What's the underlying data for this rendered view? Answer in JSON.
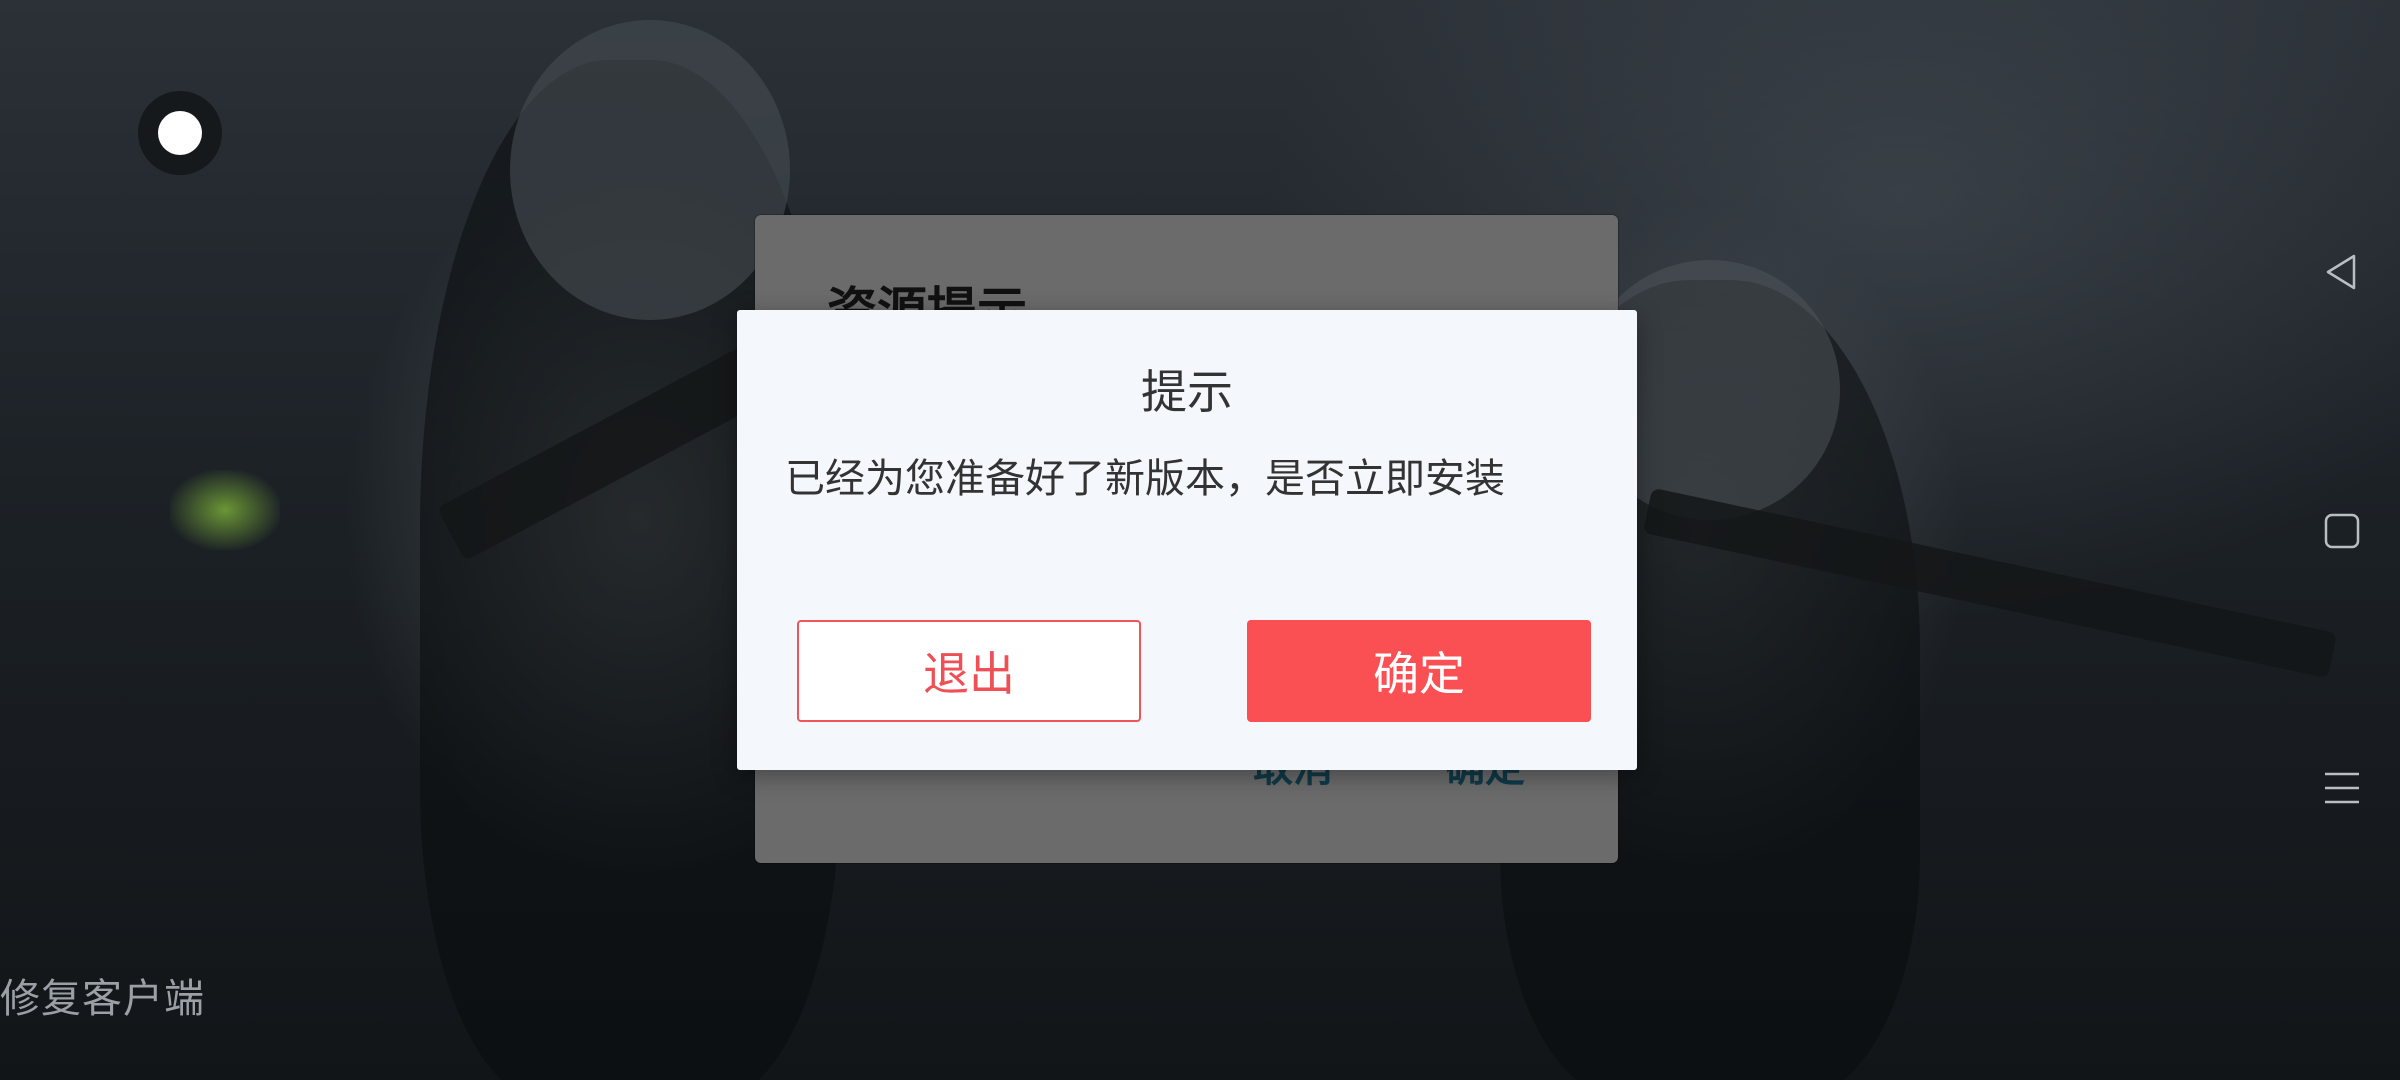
{
  "background_dialog": {
    "title": "资源提示",
    "cancel_label": "取消",
    "ok_label": "确定"
  },
  "dialog": {
    "title": "提示",
    "message": "已经为您准备好了新版本，是否立即安装",
    "exit_label": "退出",
    "ok_label": "确定"
  },
  "footer": {
    "repair_label": "修复客户端"
  },
  "nav": {
    "back_icon": "triangle-back-icon",
    "home_icon": "square-home-icon",
    "menu_icon": "three-lines-menu-icon"
  },
  "colors": {
    "primary": "#fa5053",
    "exit_border": "#f0555a",
    "dialog_bg": "#f4f8fc"
  }
}
